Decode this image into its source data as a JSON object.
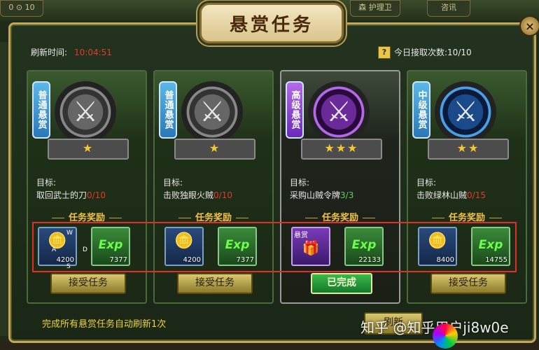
{
  "top_bar": {
    "left_chip": "0 ⊙ 10",
    "mid_chip_1": "森 护理卫",
    "mid_chip_2": "咨讯"
  },
  "title": "悬赏任务",
  "close_label": "×",
  "refresh": {
    "label": "刷新时间:",
    "time": "10:04:51"
  },
  "today": {
    "label": "今日接取次数:",
    "value": "10/10"
  },
  "target_label": "目标:",
  "reward_title": "任务奖励",
  "cards": [
    {
      "tier": "普通悬赏",
      "stars": "★",
      "target": "取回武士的刀",
      "progress": "0/10",
      "silver": "4200",
      "exp": "7377",
      "button": "接受任务"
    },
    {
      "tier": "普通悬赏",
      "stars": "★",
      "target": "击败独眼火贼",
      "progress": "0/10",
      "silver": "4200",
      "exp": "7377",
      "button": "接受任务"
    },
    {
      "tier": "高级悬赏",
      "stars": "★★★",
      "target": "采购山贼令牌",
      "progress": "3/3",
      "token_label": "悬赏",
      "exp": "22133",
      "button": "已完成"
    },
    {
      "tier": "中级悬赏",
      "stars": "★★",
      "target": "击败绿林山贼",
      "progress": "0/15",
      "silver": "8400",
      "exp": "14755",
      "button": "接受任务"
    }
  ],
  "exp_label": "Exp",
  "wasd": {
    "w": "W",
    "a": "A",
    "s": "S",
    "d": "D"
  },
  "footer": "完成所有悬赏任务自动刷新1次",
  "action_button": "刷新",
  "watermark": "知乎 @知乎用户ji8w0e"
}
